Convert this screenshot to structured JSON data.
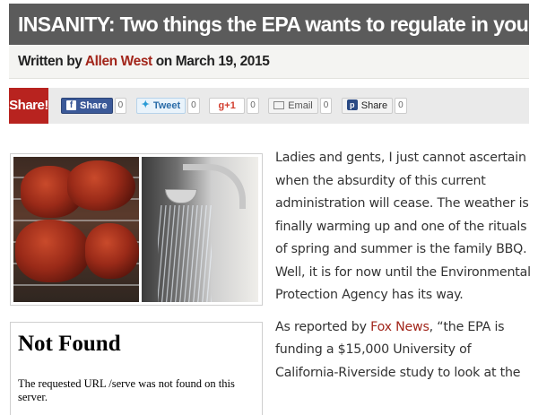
{
  "article": {
    "title": "INSANITY: Two things the EPA wants to regulate in your life",
    "byline_prefix": "Written by",
    "author": "Allen West",
    "byline_date": "on March 19, 2015",
    "paragraph1": "Ladies and gents, I just cannot ascertain when the absurdity of this current administration will cease. The weather is finally warming up and one of the rituals of spring and summer is the family BBQ. Well, it is for now until the Environmental Protection Agency has its way.",
    "paragraph2_prefix": "As reported by ",
    "paragraph2_link": "Fox News",
    "paragraph2_suffix": ", “the EPA is funding a $15,000 University of California-Riverside study to look at the"
  },
  "share_bar": {
    "label": "Share!",
    "buttons": [
      {
        "label": "Share",
        "icon": "facebook-icon",
        "count": "0"
      },
      {
        "label": "Tweet",
        "icon": "twitter-icon",
        "count": "0"
      },
      {
        "label": "+1",
        "icon": "google-plus-icon",
        "count": "0"
      },
      {
        "label": "Email",
        "icon": "email-icon",
        "count": "0"
      },
      {
        "label": "Share",
        "icon": "pocket-share-icon",
        "count": "0"
      }
    ]
  },
  "embedded_error": {
    "heading": "Not Found",
    "message": "The requested URL /serve was not found on this server."
  },
  "colors": {
    "title_bar": "#5b5b5b",
    "accent_red": "#b8231f",
    "author_link": "#a2261b",
    "facebook": "#3b5998"
  }
}
